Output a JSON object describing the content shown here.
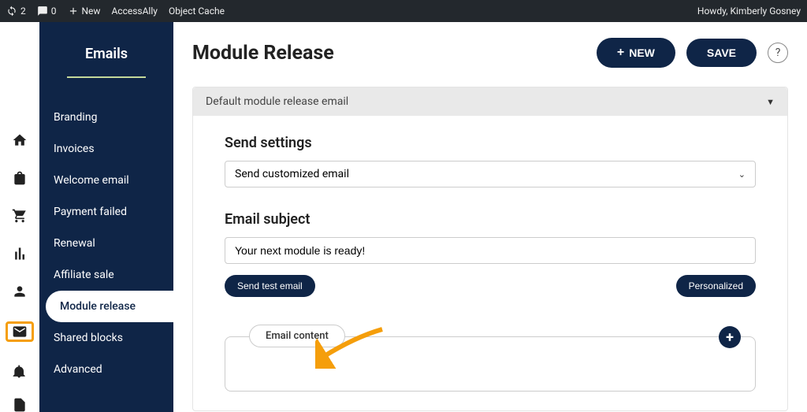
{
  "admin_bar": {
    "updates_count": "2",
    "comments_count": "0",
    "new_label": "New",
    "links": [
      "AccessAlly",
      "Object Cache"
    ],
    "greeting": "Howdy, Kimberly Gosney"
  },
  "sidebar": {
    "title": "Emails",
    "items": [
      {
        "label": "Branding",
        "active": false
      },
      {
        "label": "Invoices",
        "active": false
      },
      {
        "label": "Welcome email",
        "active": false
      },
      {
        "label": "Payment failed",
        "active": false
      },
      {
        "label": "Renewal",
        "active": false
      },
      {
        "label": "Affiliate sale",
        "active": false
      },
      {
        "label": "Module release",
        "active": true
      },
      {
        "label": "Shared blocks",
        "active": false
      },
      {
        "label": "Advanced",
        "active": false
      }
    ]
  },
  "rail": {
    "icons": [
      "home-icon",
      "shop-icon",
      "cart-icon",
      "chart-icon",
      "user-icon",
      "mail-icon",
      "megaphone-icon",
      "page-icon"
    ],
    "active": "mail-icon"
  },
  "main": {
    "title": "Module Release",
    "new_label": "NEW",
    "save_label": "SAVE",
    "panel_header": "Default module release email",
    "send_settings_title": "Send settings",
    "send_select_value": "Send customized email",
    "subject_title": "Email subject",
    "subject_value": "Your next module is ready!",
    "send_test_label": "Send test email",
    "personalized_label": "Personalized",
    "content_tab_label": "Email content"
  },
  "colors": {
    "navy": "#0f2547",
    "highlight": "#f59e0b"
  }
}
